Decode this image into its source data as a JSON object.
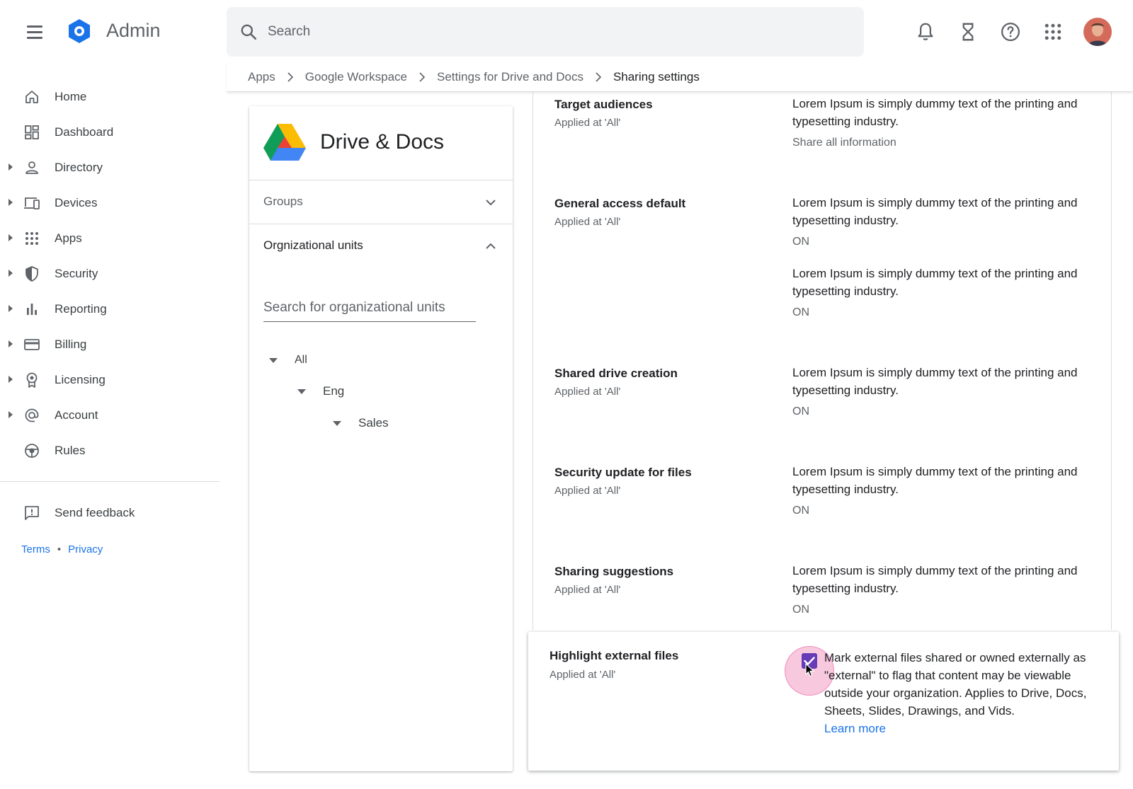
{
  "header": {
    "app_title": "Admin",
    "search_placeholder": "Search",
    "icons": [
      "menu-icon",
      "notifications-icon",
      "hourglass-icon",
      "help-icon",
      "apps-grid-icon",
      "avatar"
    ]
  },
  "breadcrumb": {
    "items": [
      "Apps",
      "Google Workspace",
      "Settings for Drive and Docs",
      "Sharing settings"
    ]
  },
  "sidebar": {
    "items": [
      {
        "label": "Home",
        "icon": "home-icon",
        "expandable": false
      },
      {
        "label": "Dashboard",
        "icon": "dashboard-icon",
        "expandable": false
      },
      {
        "label": "Directory",
        "icon": "person-icon",
        "expandable": true
      },
      {
        "label": "Devices",
        "icon": "devices-icon",
        "expandable": true
      },
      {
        "label": "Apps",
        "icon": "apps-grid-icon",
        "expandable": true
      },
      {
        "label": "Security",
        "icon": "shield-icon",
        "expandable": true
      },
      {
        "label": "Reporting",
        "icon": "bar-chart-icon",
        "expandable": true
      },
      {
        "label": "Billing",
        "icon": "credit-card-icon",
        "expandable": true
      },
      {
        "label": "Licensing",
        "icon": "badge-icon",
        "expandable": true
      },
      {
        "label": "Account",
        "icon": "at-sign-icon",
        "expandable": true
      },
      {
        "label": "Rules",
        "icon": "rules-icon",
        "expandable": false
      }
    ],
    "feedback_label": "Send feedback",
    "terms_label": "Terms",
    "privacy_label": "Privacy",
    "footer_separator": "•"
  },
  "panel": {
    "title": "Drive & Docs",
    "groups_label": "Groups",
    "org_units_label": "Orgnizational units",
    "org_search_placeholder": "Search for organizational units",
    "tree": [
      "All",
      "Eng",
      "Sales"
    ]
  },
  "settings": [
    {
      "title": "Target audiences",
      "applied": "Applied at 'All'",
      "blocks": [
        {
          "desc": "Lorem Ipsum is simply dummy text of the printing and typesetting industry.",
          "status": "Share all information"
        }
      ]
    },
    {
      "title": "General access default",
      "applied": "Applied at 'All'",
      "blocks": [
        {
          "desc": "Lorem Ipsum is simply dummy text of the printing and typesetting industry.",
          "status": "ON"
        },
        {
          "desc": "Lorem Ipsum is simply dummy text of the printing and typesetting industry.",
          "status": "ON"
        }
      ]
    },
    {
      "title": "Shared drive creation",
      "applied": "Applied at 'All'",
      "blocks": [
        {
          "desc": "Lorem Ipsum is simply dummy text of the printing and typesetting industry.",
          "status": "ON"
        }
      ]
    },
    {
      "title": "Security update for files",
      "applied": "Applied at 'All'",
      "blocks": [
        {
          "desc": "Lorem Ipsum is simply dummy text of the printing and typesetting industry.",
          "status": "ON"
        }
      ]
    },
    {
      "title": "Sharing suggestions",
      "applied": "Applied at 'All'",
      "blocks": [
        {
          "desc": "Lorem Ipsum is simply dummy text of the printing and typesetting industry.",
          "status": "ON"
        }
      ]
    }
  ],
  "highlight": {
    "title": "Highlight external files",
    "applied": "Applied at 'All'",
    "checked": true,
    "desc": "Mark external files shared or owned externally as \"external\" to flag that content may be viewable outside your organization. Applies to Drive, Docs, Sheets, Slides, Drawings, and Vids.",
    "learn_more": "Learn more"
  },
  "colors": {
    "accent": "#1a73e8",
    "checkbox": "#673ab7",
    "ripple": "#ec64a0"
  }
}
